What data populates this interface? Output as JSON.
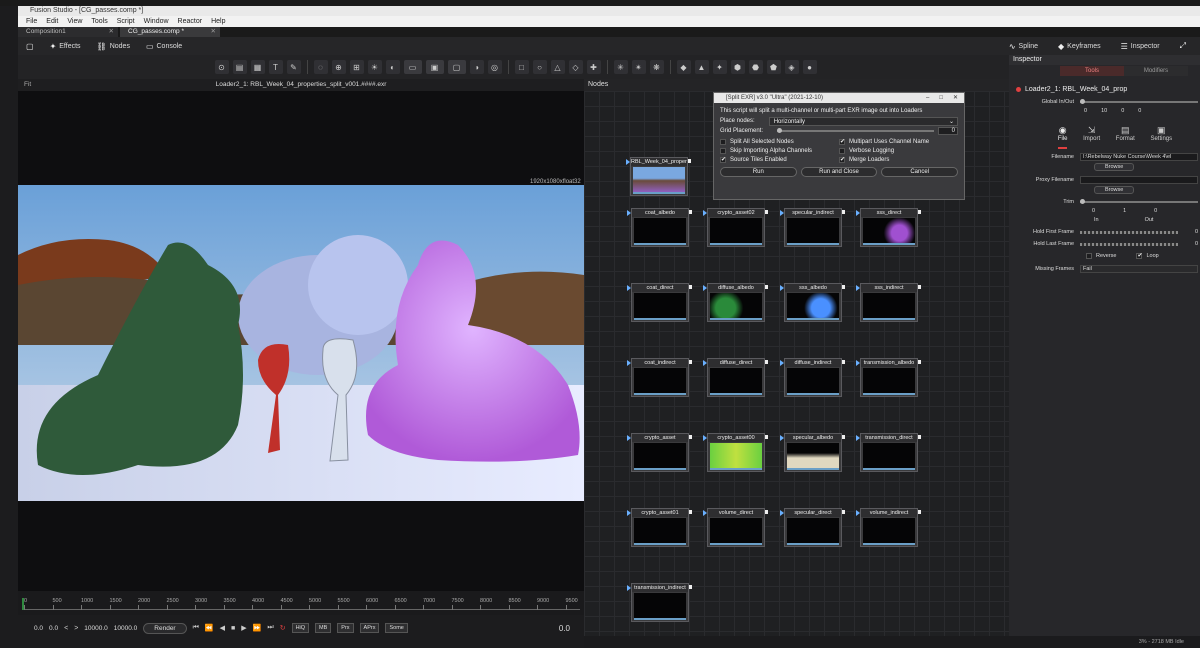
{
  "window": {
    "title": "Fusion Studio - [CG_passes.comp *]"
  },
  "menu": [
    "File",
    "Edit",
    "View",
    "Tools",
    "Script",
    "Window",
    "Reactor",
    "Help"
  ],
  "tabs": [
    {
      "label": "Composition1",
      "active": false
    },
    {
      "label": "CG_passes.comp *",
      "active": true
    }
  ],
  "toolbar": {
    "effects": "Effects",
    "nodes": "Nodes",
    "console": "Console",
    "spline": "Spline",
    "keyframes": "Keyframes",
    "inspector": "Inspector"
  },
  "viewer": {
    "fit_label": "Fit",
    "title": "Loader2_1: RBL_Week_04_properties_split_v001.####.exr",
    "resolution": "1920x1080xfloat32"
  },
  "timeline": {
    "ticks": [
      "0",
      "500",
      "1000",
      "1500",
      "2000",
      "2500",
      "3000",
      "3500",
      "4000",
      "4500",
      "5000",
      "5500",
      "6000",
      "6500",
      "7000",
      "7500",
      "8000",
      "8500",
      "9000",
      "9500"
    ],
    "start": "0.0",
    "current_a": "0.0",
    "end_a": "10000.0",
    "end_b": "10000.0",
    "render_label": "Render",
    "hiq": "HiQ",
    "mb": "MB",
    "prx": "Prx",
    "aprx": "APrx",
    "some": "Some",
    "current_frame": "0.0"
  },
  "nodes_panel": {
    "title": "Nodes",
    "loader_label": "RBL_Week_04_proper...",
    "nodes": [
      [
        "coat_albedo",
        "crypto_asset02",
        "specular_indirect",
        "sss_direct"
      ],
      [
        "coat_direct",
        "diffuse_albedo",
        "sss_albedo",
        "sss_indirect"
      ],
      [
        "coat_indirect",
        "diffuse_direct",
        "diffuse_indirect",
        "transmission_albedo"
      ],
      [
        "crypto_asset",
        "crypto_asset00",
        "specular_albedo",
        "transmission_direct"
      ],
      [
        "crypto_asset01",
        "volume_direct",
        "specular_direct",
        "volume_indirect"
      ],
      [
        "transmission_indirect"
      ]
    ]
  },
  "dialog": {
    "title": "[Split EXR] v3.0 \"Ultra\" (2021-12-10)",
    "desc": "This script will split a multi-channel or multi-part EXR image out into Loaders",
    "place_nodes_label": "Place nodes:",
    "place_nodes_value": "Horizontally",
    "grid_label": "Grid Placement:",
    "grid_value": "0",
    "checks": [
      {
        "label": "Split All Selected Nodes",
        "checked": false
      },
      {
        "label": "Multipart Uses Channel Name",
        "checked": true
      },
      {
        "label": "Skip Importing Alpha Channels",
        "checked": false
      },
      {
        "label": "Verbose Logging",
        "checked": false
      },
      {
        "label": "Source Tiles Enabled",
        "checked": true
      },
      {
        "label": "Merge Loaders",
        "checked": true
      }
    ],
    "buttons": {
      "run": "Run",
      "run_close": "Run and Close",
      "cancel": "Cancel"
    }
  },
  "inspector": {
    "title": "Inspector",
    "tabs": [
      "Tools",
      "Modifiers"
    ],
    "node_title": "Loader2_1: RBL_Week_04_prop",
    "global_label": "Global In/Out",
    "global_vals": [
      "0",
      "10",
      "0",
      "0"
    ],
    "subtabs": [
      "File",
      "Import",
      "Format",
      "Settings"
    ],
    "filename_label": "Filename",
    "filename_value": "I:\\Rebelway Nuke Course\\Week 4\\el",
    "browse": "Browse",
    "proxy_label": "Proxy Filename",
    "trim_label": "Trim",
    "trim_vals": [
      "0",
      "1",
      "0"
    ],
    "trim_in": "In",
    "trim_out": "Out",
    "hold_first": "Hold First Frame",
    "hold_first_val": "0",
    "hold_last": "Hold Last Frame",
    "hold_last_val": "0",
    "reverse": "Reverse",
    "loop": "Loop",
    "missing_label": "Missing Frames",
    "missing_value": "Fail"
  },
  "status": {
    "text": "3% - 2718 MB    Idle"
  }
}
